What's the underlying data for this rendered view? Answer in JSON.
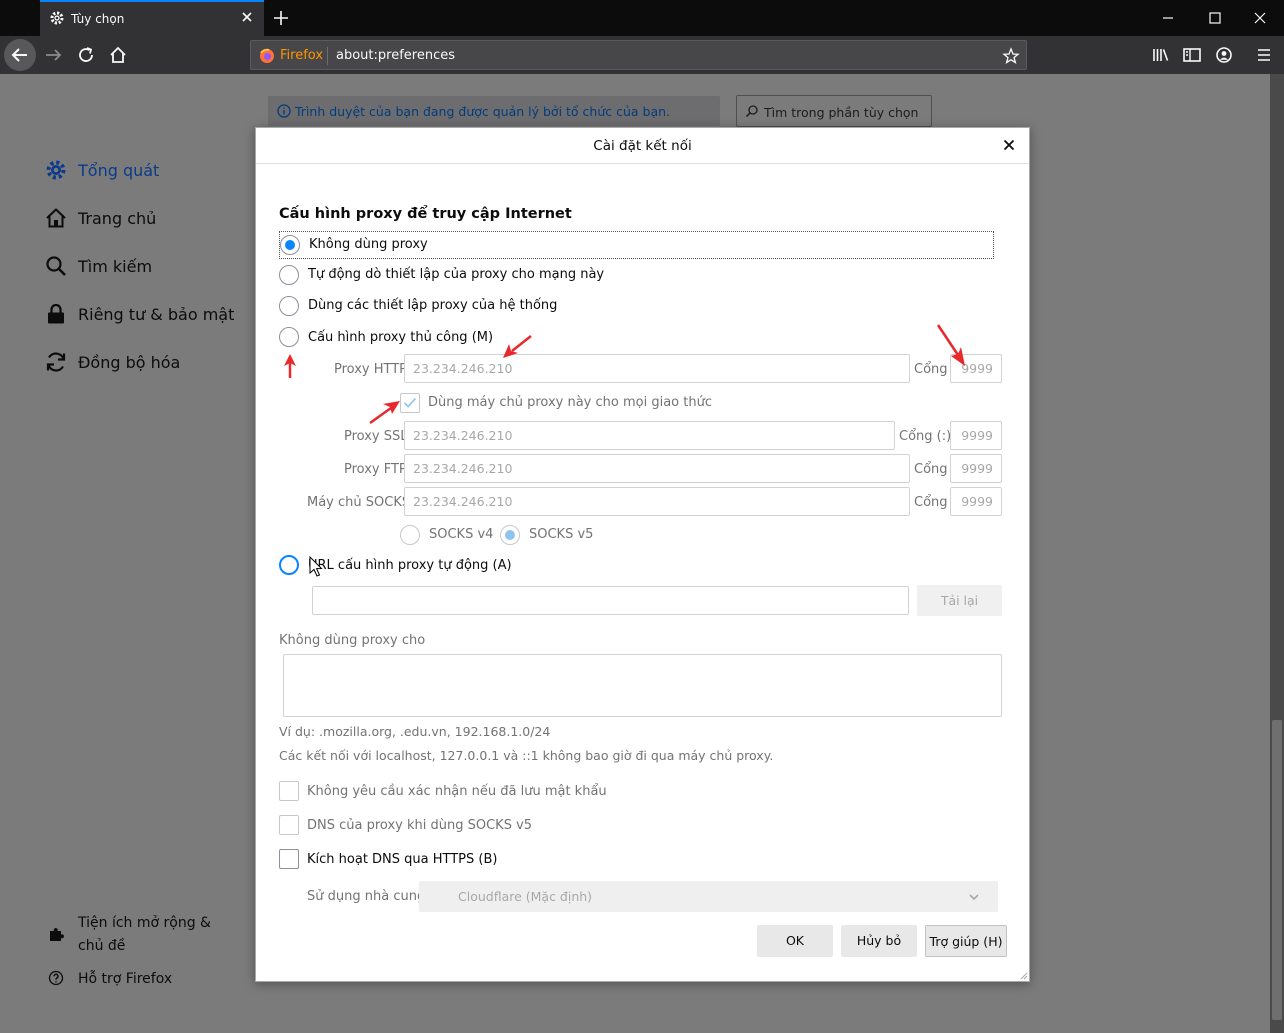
{
  "browser": {
    "tab_title": "Tùy chọn",
    "brand_label": "Firefox",
    "url": "about:preferences"
  },
  "page": {
    "managed_notice": "Trình duyệt của bạn đang được quản lý bởi tổ chức của bạn.",
    "search_placeholder": "Tìm trong phần tùy chọn",
    "categories": [
      {
        "label": "Tổng quát",
        "icon": "gear-icon",
        "selected": true
      },
      {
        "label": "Trang chủ",
        "icon": "home-icon"
      },
      {
        "label": "Tìm kiếm",
        "icon": "search-icon"
      },
      {
        "label": "Riêng tư & bảo mật",
        "icon": "lock-icon"
      },
      {
        "label": "Đồng bộ hóa",
        "icon": "sync-icon"
      }
    ],
    "footer": {
      "extensions": "Tiện ích mở rộng & chủ đề",
      "support": "Hỗ trợ Firefox"
    }
  },
  "dialog": {
    "title": "Cài đặt kết nối",
    "section_heading": "Cấu hình proxy để truy cập Internet",
    "options": {
      "no_proxy": "Không dùng proxy",
      "auto_detect": "Tự động dò thiết lập của proxy cho mạng này",
      "system": "Dùng các thiết lập proxy của hệ thống",
      "manual": "Cấu hình proxy thủ công (M)",
      "auto_url": "URL cấu hình proxy tự động (A)"
    },
    "selected_option": "no_proxy",
    "manual": {
      "http_label": "Proxy HTTP",
      "http_value": "23.234.246.210",
      "http_port_label": "Cổng",
      "http_port": "9999",
      "share_label": "Dùng máy chủ proxy này cho mọi giao thức",
      "share_checked": true,
      "ssl_label": "Proxy SSL",
      "ssl_value": "23.234.246.210",
      "ssl_port_label": "Cổng (:)",
      "ssl_port": "9999",
      "ftp_label": "Proxy FTP",
      "ftp_value": "23.234.246.210",
      "ftp_port_label": "Cổng",
      "ftp_port": "9999",
      "socks_label": "Máy chủ SOCKS",
      "socks_value": "23.234.246.210",
      "socks_port_label": "Cổng",
      "socks_port": "9999",
      "socks_v4": "SOCKS v4",
      "socks_v5": "SOCKS v5",
      "socks_selected": "v5"
    },
    "auto_url_value": "",
    "reload_button": "Tải lại",
    "no_proxy_for_label": "Không dùng proxy cho",
    "no_proxy_for_value": "",
    "example_text": "Ví dụ: .mozilla.org, .edu.vn, 192.168.1.0/24",
    "localhost_note": "Các kết nối với localhost, 127.0.0.1 và ::1 không bao giờ đi qua máy chủ proxy.",
    "checks": {
      "no_auth_prompt": "Không yêu cầu xác nhận nếu đã lưu mật khẩu",
      "socks_dns": "DNS của proxy khi dùng SOCKS v5",
      "doh": "Kích hoạt DNS qua HTTPS (B)"
    },
    "provider_label": "Sử dụng nhà cung cấp",
    "provider_value": "Cloudflare (Mặc định)",
    "buttons": {
      "ok": "OK",
      "cancel": "Hủy bỏ",
      "help": "Trợ giúp (H)"
    }
  },
  "colors": {
    "accent": "#0a84ff",
    "annotation_arrow": "#e8282b"
  }
}
